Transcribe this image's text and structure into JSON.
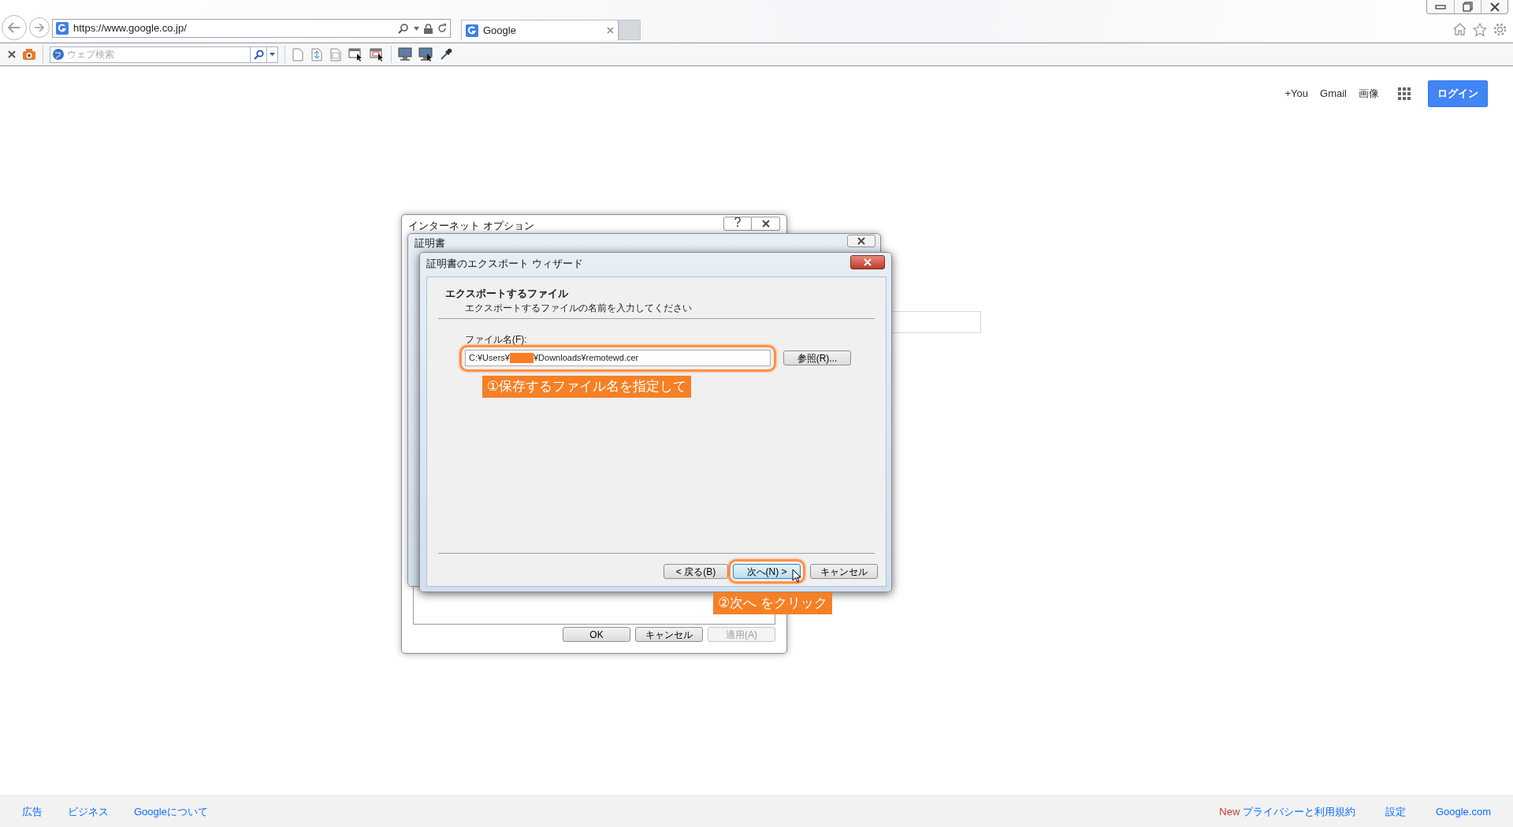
{
  "browser": {
    "address": "https://www.google.co.jp/",
    "tabs": [
      {
        "label": "Google",
        "selected": true
      }
    ],
    "search_placeholder": "ウェブ検索"
  },
  "google_header": {
    "links": [
      "+You",
      "Gmail",
      "画像"
    ],
    "login": "ログイン"
  },
  "internet_options": {
    "title": "インターネット オプション",
    "buttons": [
      {
        "label": "OK",
        "disabled": false
      },
      {
        "label": "キャンセル",
        "disabled": false
      },
      {
        "label": "適用(A)",
        "disabled": true
      }
    ]
  },
  "certificate_dialog": {
    "title": "証明書"
  },
  "wizard": {
    "title": "証明書のエクスポート ウィザード",
    "heading": "エクスポートするファイル",
    "subtitle": "エクスポートするファイルの名前を入力してください",
    "field_label": "ファイル名(F):",
    "file_path_prefix": "C:¥Users¥",
    "file_path_suffix": "¥Downloads¥remotewd.cer",
    "browse": "参照(R)...",
    "buttons": [
      {
        "label": "< 戻る(B)",
        "highlighted": false
      },
      {
        "label": "次へ(N) >",
        "highlighted": true
      },
      {
        "label": "キャンセル",
        "highlighted": false
      }
    ]
  },
  "annotations": [
    {
      "text": "①保存するファイル名を指定して"
    },
    {
      "text": "②次へ をクリック"
    }
  ],
  "footer": {
    "left": [
      "広告",
      "ビジネス",
      "Googleについて"
    ],
    "right": [
      {
        "badge": "New",
        "label": "プライバシーと利用規約"
      },
      {
        "label": "設定"
      },
      {
        "label": "Google.com"
      }
    ]
  }
}
